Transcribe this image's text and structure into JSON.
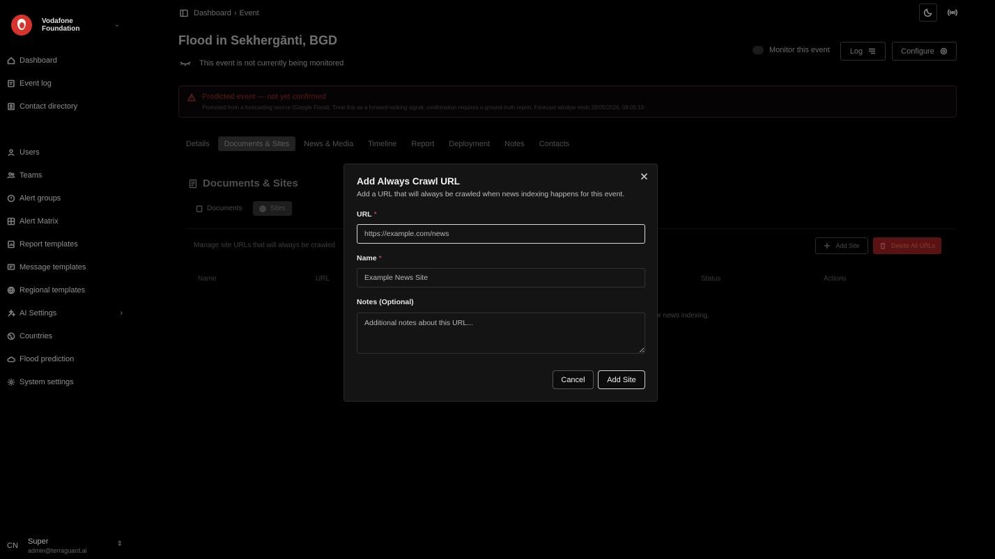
{
  "brand": {
    "line1": "Vodafone",
    "line2": "Foundation"
  },
  "sidebar": {
    "items": [
      {
        "label": "Dashboard",
        "icon": "home-icon"
      },
      {
        "label": "Event log",
        "icon": "event-log-icon"
      },
      {
        "label": "Contact directory",
        "icon": "contacts-icon"
      },
      {
        "label": "Users",
        "icon": "user-icon"
      },
      {
        "label": "Teams",
        "icon": "teams-icon"
      },
      {
        "label": "Alert groups",
        "icon": "alert-group-icon"
      },
      {
        "label": "Alert Matrix",
        "icon": "matrix-icon"
      },
      {
        "label": "Report templates",
        "icon": "report-icon"
      },
      {
        "label": "Message templates",
        "icon": "message-icon"
      },
      {
        "label": "Regional templates",
        "icon": "globe-icon"
      },
      {
        "label": "AI Settings",
        "icon": "ai-icon"
      },
      {
        "label": "Countries",
        "icon": "countries-icon"
      },
      {
        "label": "Flood prediction",
        "icon": "cloud-icon"
      },
      {
        "label": "System settings",
        "icon": "settings-icon"
      }
    ],
    "user": {
      "initials": "CN",
      "name": "Super",
      "email": "admin@terraguard.ai"
    }
  },
  "breadcrumb": {
    "item1": "Dashboard",
    "separator": "›",
    "item2": "Event"
  },
  "event": {
    "title": "Flood in Sekhergānti, BGD",
    "monitor_status": "This event is not currently being monitored",
    "monitor_toggle_label": "Monitor this event",
    "log_label": "Log",
    "configure_label": "Configure"
  },
  "alert": {
    "title": "Predicted event — not yet confirmed",
    "body": "Promoted from a forecasting source (Google Flood). Treat this as a forward-looking signal; confirmation requires a ground-truth report. Forecast window ends 28/05/2026, 08:05:19."
  },
  "tabs": [
    "Details",
    "Documents & Sites",
    "News & Media",
    "Timeline",
    "Report",
    "Deployment",
    "Notes",
    "Contacts"
  ],
  "section": {
    "title": "Documents & Sites",
    "subtabs": [
      "Documents",
      "Sites"
    ],
    "description": "Manage site URLs that will always be crawled",
    "add_site": "Add Site",
    "delete_all": "Delete All URLs",
    "columns": [
      "Name",
      "URL",
      "Status",
      "Actions"
    ],
    "empty_fragment": "or news indexing."
  },
  "modal": {
    "title": "Add Always Crawl URL",
    "description": "Add a URL that will always be crawled when news indexing happens for this event.",
    "url_label": "URL",
    "url_placeholder": "https://example.com/news",
    "name_label": "Name",
    "name_placeholder": "Example News Site",
    "notes_label": "Notes (Optional)",
    "notes_placeholder": "Additional notes about this URL...",
    "required_mark": "*",
    "cancel": "Cancel",
    "submit": "Add Site"
  },
  "colors": {
    "danger": "#d9342b",
    "delete_button": "#5a1212",
    "background": "#000000",
    "modal": "#141414"
  }
}
